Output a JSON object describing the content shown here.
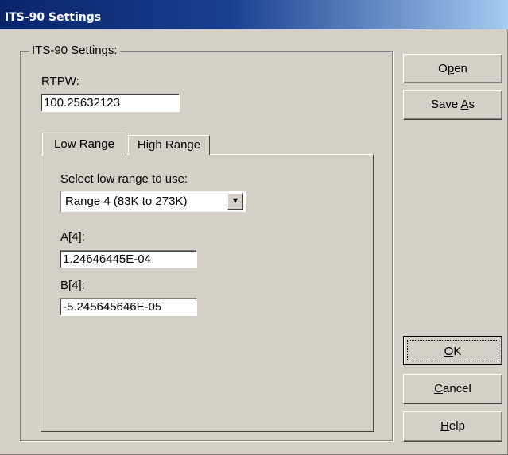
{
  "window": {
    "title": "ITS-90 Settings"
  },
  "group": {
    "label": "ITS-90 Settings:"
  },
  "rtpw": {
    "label": "RTPW:",
    "value": "100.25632123"
  },
  "tabs": [
    {
      "label": "Low Range",
      "selected": true
    },
    {
      "label": "High Range",
      "selected": false
    }
  ],
  "low_range": {
    "select_label": "Select low range to use:",
    "selected_range": "Range 4 (83K to 273K)",
    "a_label": "A[4]:",
    "a_value": "1.24646445E-04",
    "b_label": "B[4]:",
    "b_value": "-5.245645646E-05"
  },
  "buttons": {
    "open": {
      "pre": "O",
      "key": "p",
      "post": "en"
    },
    "save_as": {
      "pre": "Save ",
      "key": "A",
      "post": "s"
    },
    "ok": {
      "pre": "",
      "key": "O",
      "post": "K"
    },
    "cancel": {
      "pre": "",
      "key": "C",
      "post": "ancel"
    },
    "help": {
      "pre": "",
      "key": "H",
      "post": "elp"
    }
  },
  "icons": {
    "dropdown": "dropdown-arrow-icon"
  },
  "colors": {
    "face": "#d4d0c8",
    "title_start": "#0a246a",
    "title_end": "#a6caf0"
  }
}
